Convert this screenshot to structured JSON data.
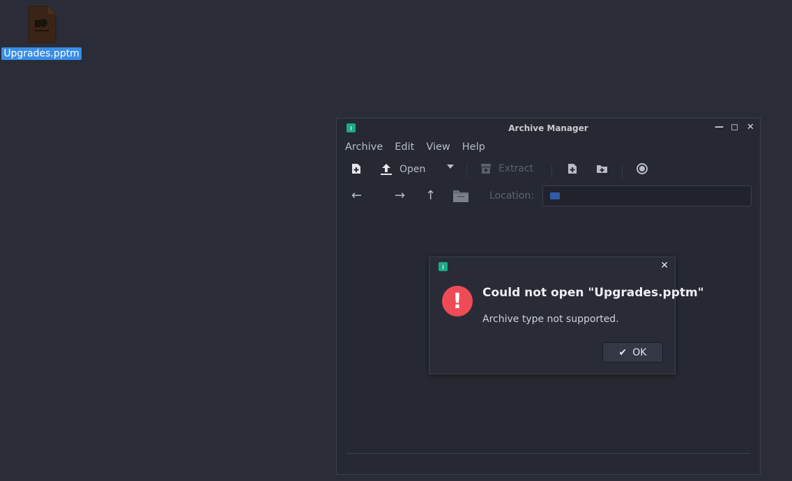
{
  "desktop": {
    "file_label": "Upgrades.pptm"
  },
  "window": {
    "title": "Archive Manager",
    "menu": [
      "Archive",
      "Edit",
      "View",
      "Help"
    ],
    "toolbar": {
      "open_label": "Open",
      "extract_label": "Extract"
    },
    "location_label": "Location:",
    "location_value": ""
  },
  "dialog": {
    "title": "Could not open \"Upgrades.pptm\"",
    "message": "Archive type not supported.",
    "ok_label": "OK"
  },
  "colors": {
    "desktop_bg": "#2a2d38",
    "selection": "#3a8ee8",
    "app_icon": "#1bab86",
    "error": "#ef4b56"
  }
}
